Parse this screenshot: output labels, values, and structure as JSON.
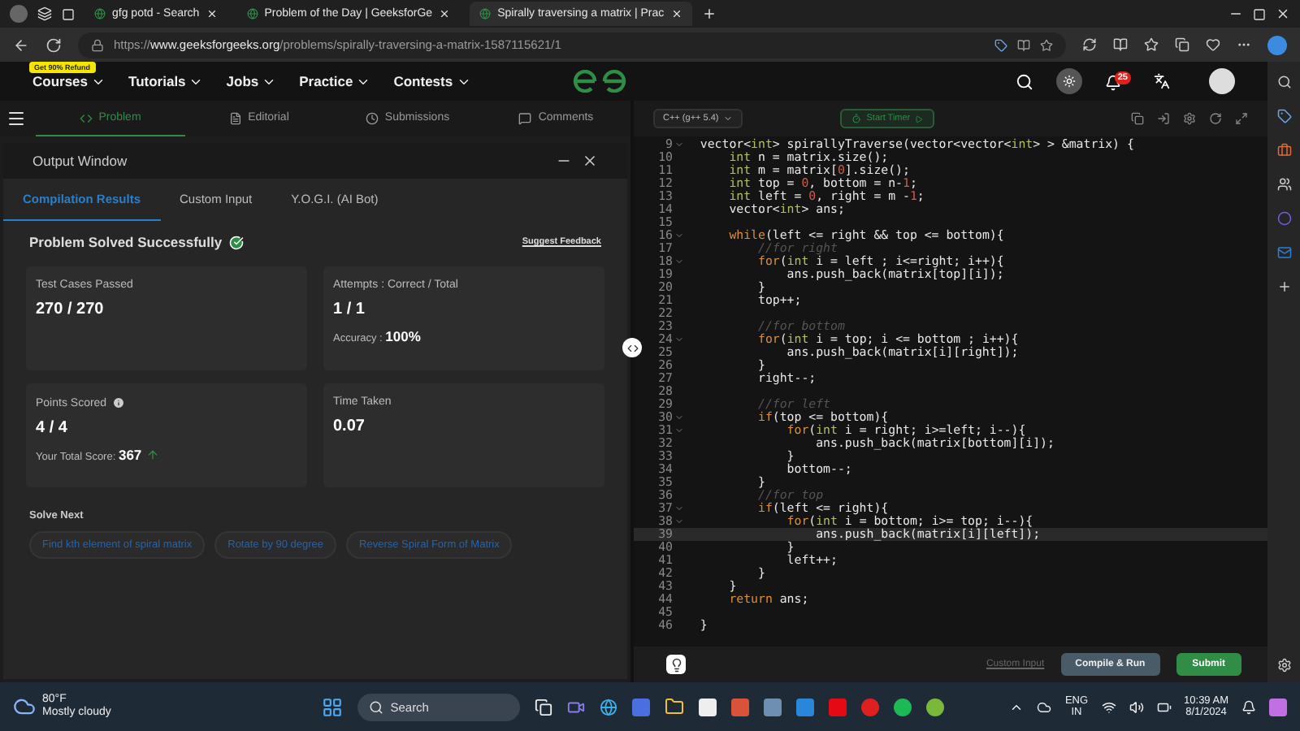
{
  "browser": {
    "tabs": [
      {
        "title": "gfg potd - Search",
        "selected": false
      },
      {
        "title": "Problem of the Day | GeeksforGe",
        "selected": false
      },
      {
        "title": "Spirally traversing a matrix | Prac",
        "selected": true
      }
    ],
    "url": "https://**www.geeksforgeeks.org**/problems/spirally-traversing-a-matrix-1587115621/1"
  },
  "site_nav": {
    "badge": "Get 90% Refund",
    "items": [
      "Courses",
      "Tutorials",
      "Jobs",
      "Practice",
      "Contests"
    ],
    "notification_count": "25"
  },
  "problem_tabs": [
    {
      "label": "Problem",
      "kind": "code",
      "selected": true
    },
    {
      "label": "Editorial",
      "kind": "doc",
      "selected": false
    },
    {
      "label": "Submissions",
      "kind": "clock",
      "selected": false
    },
    {
      "label": "Comments",
      "kind": "chat",
      "selected": false
    }
  ],
  "output_window": {
    "title": "Output Window",
    "tabs": [
      {
        "label": "Compilation Results",
        "selected": true
      },
      {
        "label": "Custom Input",
        "selected": false
      },
      {
        "label": "Y.O.G.I. (AI Bot)",
        "selected": false
      }
    ],
    "status": "Problem Solved Successfully",
    "feedback_link": "Suggest Feedback",
    "cards": [
      {
        "label": "Test Cases Passed",
        "value": "270 / 270",
        "info": false
      },
      {
        "label": "Attempts : Correct / Total",
        "value": "1 / 1",
        "note_label": "Accuracy :",
        "note_value": "100%",
        "info": false
      },
      {
        "label": "Points Scored",
        "value": "4 / 4",
        "note_label": "Your Total Score:",
        "note_value": "367",
        "trend_up": true,
        "info": true
      },
      {
        "label": "Time Taken",
        "value": "0.07",
        "info": false
      }
    ],
    "solve_next_title": "Solve Next",
    "solve_next": [
      "Find kth element of spiral matrix",
      "Rotate by 90 degree",
      "Reverse Spiral Form of Matrix"
    ]
  },
  "editor": {
    "language": "C++ (g++ 5.4)",
    "timer_button": "Start Timer",
    "lines": [
      {
        "num": "9",
        "foldable": true,
        "current": false,
        "tokens": [
          {
            "kind": "plain",
            "text": "  vector<"
          },
          {
            "kind": "type",
            "text": "int"
          },
          {
            "kind": "plain",
            "text": "> spirallyTraverse(vector<vector<"
          },
          {
            "kind": "type",
            "text": "int"
          },
          {
            "kind": "plain",
            "text": "> > &matrix) {"
          }
        ]
      },
      {
        "num": "10",
        "foldable": false,
        "current": false,
        "tokens": [
          {
            "kind": "type",
            "text": "      int"
          },
          {
            "kind": "plain",
            "text": " n = matrix.size();"
          }
        ]
      },
      {
        "num": "11",
        "foldable": false,
        "current": false,
        "tokens": [
          {
            "kind": "type",
            "text": "      int"
          },
          {
            "kind": "plain",
            "text": " m = matrix["
          },
          {
            "kind": "number",
            "text": "0"
          },
          {
            "kind": "plain",
            "text": "].size();"
          }
        ]
      },
      {
        "num": "12",
        "foldable": false,
        "current": false,
        "tokens": [
          {
            "kind": "type",
            "text": "      int"
          },
          {
            "kind": "plain",
            "text": " top = "
          },
          {
            "kind": "number",
            "text": "0"
          },
          {
            "kind": "plain",
            "text": ", bottom = n-"
          },
          {
            "kind": "number",
            "text": "1"
          },
          {
            "kind": "plain",
            "text": ";"
          }
        ]
      },
      {
        "num": "13",
        "foldable": false,
        "current": false,
        "tokens": [
          {
            "kind": "type",
            "text": "      int"
          },
          {
            "kind": "plain",
            "text": " left = "
          },
          {
            "kind": "number",
            "text": "0"
          },
          {
            "kind": "plain",
            "text": ", right = m -"
          },
          {
            "kind": "number",
            "text": "1"
          },
          {
            "kind": "plain",
            "text": ";"
          }
        ]
      },
      {
        "num": "14",
        "foldable": false,
        "current": false,
        "tokens": [
          {
            "kind": "plain",
            "text": "      vector<"
          },
          {
            "kind": "type",
            "text": "int"
          },
          {
            "kind": "plain",
            "text": "> ans;"
          }
        ]
      },
      {
        "num": "15",
        "foldable": false,
        "current": false
      },
      {
        "num": "16",
        "foldable": true,
        "current": false,
        "tokens": [
          {
            "kind": "keyword",
            "text": "      while"
          },
          {
            "kind": "plain",
            "text": "(left <= right && top <= bottom){"
          }
        ]
      },
      {
        "num": "17",
        "foldable": false,
        "current": false,
        "tokens": [
          {
            "kind": "comment",
            "text": "          //for right"
          }
        ]
      },
      {
        "num": "18",
        "foldable": true,
        "current": false,
        "tokens": [
          {
            "kind": "keyword",
            "text": "          for"
          },
          {
            "kind": "plain",
            "text": "("
          },
          {
            "kind": "type",
            "text": "int"
          },
          {
            "kind": "plain",
            "text": " i = left ; i<=right; i++){"
          }
        ]
      },
      {
        "num": "19",
        "foldable": false,
        "current": false,
        "tokens": [
          {
            "kind": "plain",
            "text": "              ans.push_back(matrix[top][i]);"
          }
        ]
      },
      {
        "num": "20",
        "foldable": false,
        "current": false,
        "tokens": [
          {
            "kind": "plain",
            "text": "          }"
          }
        ]
      },
      {
        "num": "21",
        "foldable": false,
        "current": false,
        "tokens": [
          {
            "kind": "plain",
            "text": "          top++;"
          }
        ]
      },
      {
        "num": "22",
        "foldable": false,
        "current": false
      },
      {
        "num": "23",
        "foldable": false,
        "current": false,
        "tokens": [
          {
            "kind": "comment",
            "text": "          //for bottom"
          }
        ]
      },
      {
        "num": "24",
        "foldable": true,
        "current": false,
        "tokens": [
          {
            "kind": "keyword",
            "text": "          for"
          },
          {
            "kind": "plain",
            "text": "("
          },
          {
            "kind": "type",
            "text": "int"
          },
          {
            "kind": "plain",
            "text": " i = top; i <= bottom ; i++){"
          }
        ]
      },
      {
        "num": "25",
        "foldable": false,
        "current": false,
        "tokens": [
          {
            "kind": "plain",
            "text": "              ans.push_back(matrix[i][right]);"
          }
        ]
      },
      {
        "num": "26",
        "foldable": false,
        "current": false,
        "tokens": [
          {
            "kind": "plain",
            "text": "          }"
          }
        ]
      },
      {
        "num": "27",
        "foldable": false,
        "current": false,
        "tokens": [
          {
            "kind": "plain",
            "text": "          right--;"
          }
        ]
      },
      {
        "num": "28",
        "foldable": false,
        "current": false
      },
      {
        "num": "29",
        "foldable": false,
        "current": false,
        "tokens": [
          {
            "kind": "comment",
            "text": "          //for left"
          }
        ]
      },
      {
        "num": "30",
        "foldable": true,
        "current": false,
        "tokens": [
          {
            "kind": "keyword",
            "text": "          if"
          },
          {
            "kind": "plain",
            "text": "(top <= bottom){"
          }
        ]
      },
      {
        "num": "31",
        "foldable": true,
        "current": false,
        "tokens": [
          {
            "kind": "keyword",
            "text": "              for"
          },
          {
            "kind": "plain",
            "text": "("
          },
          {
            "kind": "type",
            "text": "int"
          },
          {
            "kind": "plain",
            "text": " i = right; i>=left; i--){"
          }
        ]
      },
      {
        "num": "32",
        "foldable": false,
        "current": false,
        "tokens": [
          {
            "kind": "plain",
            "text": "                  ans.push_back(matrix[bottom][i]);"
          }
        ]
      },
      {
        "num": "33",
        "foldable": false,
        "current": false,
        "tokens": [
          {
            "kind": "plain",
            "text": "              }"
          }
        ]
      },
      {
        "num": "34",
        "foldable": false,
        "current": false,
        "tokens": [
          {
            "kind": "plain",
            "text": "              bottom--;"
          }
        ]
      },
      {
        "num": "35",
        "foldable": false,
        "current": false,
        "tokens": [
          {
            "kind": "plain",
            "text": "          }"
          }
        ]
      },
      {
        "num": "36",
        "foldable": false,
        "current": false,
        "tokens": [
          {
            "kind": "comment",
            "text": "          //for top"
          }
        ]
      },
      {
        "num": "37",
        "foldable": true,
        "current": false,
        "tokens": [
          {
            "kind": "keyword",
            "text": "          if"
          },
          {
            "kind": "plain",
            "text": "(left <= right){"
          }
        ]
      },
      {
        "num": "38",
        "foldable": true,
        "current": false,
        "tokens": [
          {
            "kind": "keyword",
            "text": "              for"
          },
          {
            "kind": "plain",
            "text": "("
          },
          {
            "kind": "type",
            "text": "int"
          },
          {
            "kind": "plain",
            "text": " i = bottom; i>= top; i--){"
          }
        ]
      },
      {
        "num": "39",
        "foldable": false,
        "current": true,
        "tokens": [
          {
            "kind": "plain",
            "text": "                  ans.push_back(matrix[i][left]);"
          }
        ]
      },
      {
        "num": "40",
        "foldable": false,
        "current": false,
        "tokens": [
          {
            "kind": "plain",
            "text": "              }"
          }
        ]
      },
      {
        "num": "41",
        "foldable": false,
        "current": false,
        "tokens": [
          {
            "kind": "plain",
            "text": "              left++;"
          }
        ]
      },
      {
        "num": "42",
        "foldable": false,
        "current": false,
        "tokens": [
          {
            "kind": "plain",
            "text": "          }"
          }
        ]
      },
      {
        "num": "43",
        "foldable": false,
        "current": false,
        "tokens": [
          {
            "kind": "plain",
            "text": "      }"
          }
        ]
      },
      {
        "num": "44",
        "foldable": false,
        "current": false,
        "tokens": [
          {
            "kind": "keyword",
            "text": "      return"
          },
          {
            "kind": "plain",
            "text": " ans;"
          }
        ]
      },
      {
        "num": "45",
        "foldable": false,
        "current": false
      },
      {
        "num": "46",
        "foldable": false,
        "current": false,
        "tokens": [
          {
            "kind": "plain",
            "text": "  }"
          }
        ]
      }
    ],
    "custom_input_link": "Custom Input",
    "compile_button": "Compile & Run",
    "submit_button": "Submit"
  },
  "taskbar": {
    "temperature": "80°F",
    "weather": "Mostly cloudy",
    "search_placeholder": "Search",
    "language": "ENG",
    "region": "IN",
    "time": "10:39 AM",
    "date": "8/1/2024"
  }
}
